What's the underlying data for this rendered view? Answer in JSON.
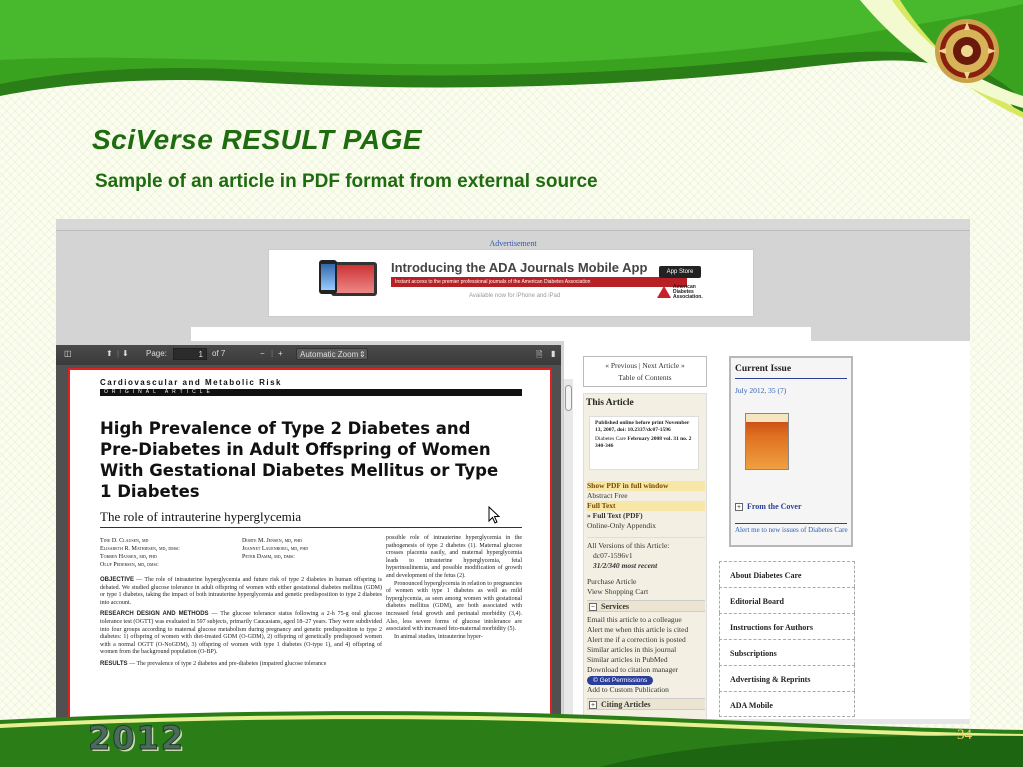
{
  "slide": {
    "title": "SciVerse RESULT PAGE",
    "subtitle": "Sample of an article in PDF format from external source",
    "year": "2012",
    "page_number": "34"
  },
  "advertisement": {
    "label": "Advertisement",
    "headline": "Introducing the ADA Journals Mobile App",
    "tagline": "Instant access to the premier professional journals of the American Diabetes Association",
    "availability": "Available now for iPhone and iPad",
    "store_badge": "App Store",
    "logo_text": "American Diabetes Association."
  },
  "pdf_viewer": {
    "page_label": "Page:",
    "page_current": "1",
    "page_total": "of 7",
    "zoom": "Automatic Zoom",
    "zoom_minus": "−",
    "zoom_plus": "+"
  },
  "article": {
    "journal": "Cardiovascular and Metabolic Risk",
    "section": "ORIGINAL ARTICLE",
    "title": "High Prevalence of Type 2 Diabetes and Pre-Diabetes in Adult Offspring of Women With Gestational Diabetes Mellitus or Type 1 Diabetes",
    "subtitle": "The role of intrauterine hyperglycemia",
    "authors_col1": [
      "Tine D. Clausen, md",
      "Elisabeth R. Mathiesen, md, dmsc",
      "Torben Hansen, md, phd",
      "Oluf Pedersen, md, dmsc"
    ],
    "authors_col2": [
      "Dorte M. Jensen, md, phd",
      "Jeannet Lauenborg, md, phd",
      "Peter Damm, md, dmsc"
    ],
    "objective_head": "OBJECTIVE",
    "objective_text": "— The role of intrauterine hyperglycemia and future risk of type 2 diabetes in human offspring is debated. We studied glucose tolerance in adult offspring of women with either gestational diabetes mellitus (GDM) or type 1 diabetes, taking the impact of both intrauterine hyperglycemia and genetic predisposition to type 2 diabetes into account.",
    "methods_head": "RESEARCH DESIGN AND METHODS",
    "methods_text": "— The glucose tolerance status following a 2-h 75-g oral glucose tolerance test (OGTT) was evaluated in 597 subjects, primarily Caucasians, aged 18–27 years. They were subdivided into four groups according to maternal glucose metabolism during pregnancy and genetic predisposition to type 2 diabetes: 1) offspring of women with diet-treated GDM (O-GDM), 2) offspring of genetically predisposed women with a normal OGTT (O-NoGDM), 3) offspring of women with type 1 diabetes (O-type 1), and 4) offspring of women from the background population (O-BP).",
    "results_head": "RESULTS",
    "results_text": "— The prevalence of type 2 diabetes and pre-diabetes (impaired glucose tolerance",
    "right_col": "possible role of intrauterine hyperglycemia in the pathogenesis of type 2 diabetes (1). Maternal glucose crosses placenta easily, and maternal hyperglycemia leads to intrauterine hyperglycemia, fetal hyperinsulinemia, and possible modification of growth and development of the fetus (2).",
    "right_col2": "Pronounced hyperglycemia in relation to pregnancies of women with type 1 diabetes as well as mild hyperglycemia, as seen among women with gestational diabetes mellitus (GDM), are both associated with increased fetal growth and perinatal morbidity (3,4). Also, less severe forms of glucose intolerance are associated with increased feto-maternal morbidity (5).",
    "right_col3": "In animal studies, intrauterine hyper-"
  },
  "navigation": {
    "prev_next": "« Previous | Next Article »",
    "toc": "Table of Contents"
  },
  "this_article": {
    "heading": "This Article",
    "published": "Published online before print November 13, 2007, doi: 10.2337/dc07-1596",
    "citation_prefix": "Diabetes Care",
    "citation": "February 2008 vol. 31 no. 2 340-346",
    "links": [
      {
        "text": "Show PDF in full window",
        "style": "hl"
      },
      {
        "text": "Abstract Free",
        "style": "plain"
      },
      {
        "text": "Full Text",
        "style": "hl"
      },
      {
        "text": "» Full Text (PDF)",
        "style": "bold"
      },
      {
        "text": "Online-Only Appendix",
        "style": "plain"
      }
    ],
    "versions_label": "All Versions of this Article:",
    "versions": [
      "dc07-1596v1",
      "31/2/340 most recent"
    ],
    "purchase": "Purchase Article",
    "cart": "View Shopping Cart",
    "services_head": "Services",
    "services": [
      "Email this article to a colleague",
      "Alert me when this article is cited",
      "Alert me if a correction is posted",
      "Similar articles in this journal",
      "Similar articles in PubMed",
      "Download to citation manager"
    ],
    "permissions": "Get Permissions",
    "custom_pub": "Add to Custom Publication",
    "citing_head": "Citing Articles"
  },
  "current_issue": {
    "heading": "Current Issue",
    "date": "July 2012, 35 (7)",
    "from_cover": "From the Cover",
    "alert": "Alert me to new issues of Diabetes Care"
  },
  "about_links": [
    "About Diabetes Care",
    "Editorial Board",
    "Instructions for Authors",
    "Subscriptions",
    "Advertising & Reprints",
    "ADA Mobile"
  ],
  "colors": {
    "slide_green": "#1f6b10",
    "page_border": "#e02020",
    "link_blue": "#2b5fb4"
  }
}
